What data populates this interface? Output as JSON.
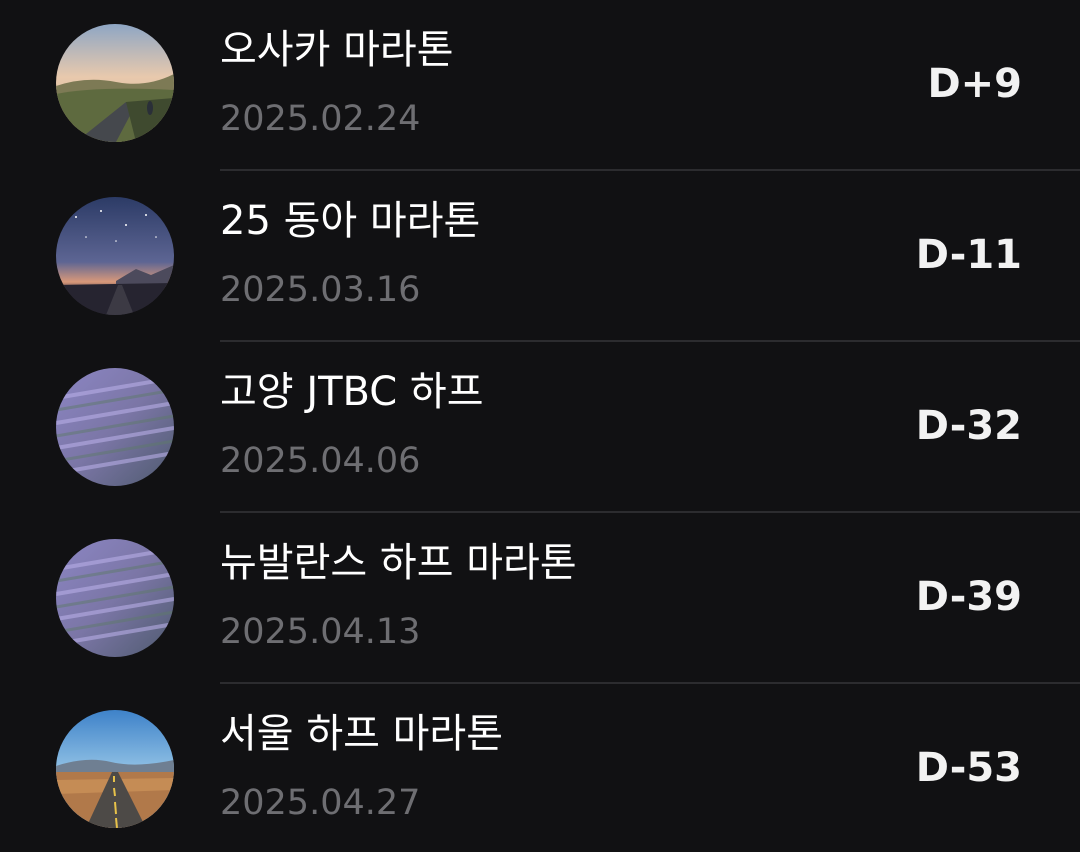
{
  "races": [
    {
      "title": "오사카 마라톤",
      "date": "2025.02.24",
      "dday": "D+9",
      "thumbnail": "hill-road-runner-image"
    },
    {
      "title": "25 동아 마라톤",
      "date": "2025.03.16",
      "dday": "D-11",
      "thumbnail": "starry-night-road-image"
    },
    {
      "title": "고양 JTBC 하프",
      "date": "2025.04.06",
      "dday": "D-32",
      "thumbnail": "lavender-field-image"
    },
    {
      "title": "뉴발란스 하프 마라톤",
      "date": "2025.04.13",
      "dday": "D-39",
      "thumbnail": "lavender-field-image"
    },
    {
      "title": "서울 하프 마라톤",
      "date": "2025.04.27",
      "dday": "D-53",
      "thumbnail": "desert-highway-image"
    }
  ],
  "colors": {
    "background": "#111113",
    "title": "#ffffff",
    "date": "#6e6e72",
    "dday": "#f2f2f2",
    "divider": "#2c2c2f"
  }
}
